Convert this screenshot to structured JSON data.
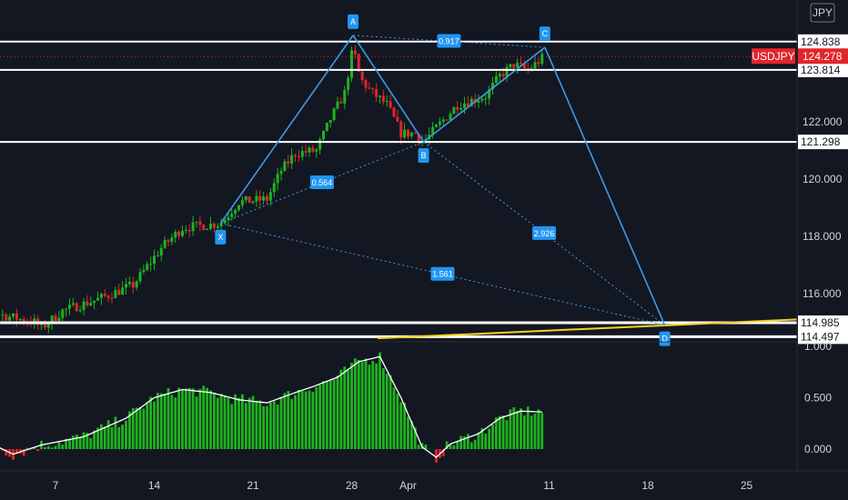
{
  "chart_data": {
    "type": "candlestick",
    "symbol": "USDJPY",
    "last_price": "124.278",
    "colors": {
      "background": "#131722",
      "up": "#1fb21f",
      "down": "#e0262c",
      "pattern": "#3d9ae8",
      "level": "#ffffff",
      "trend": "#f5d020",
      "osc_line": "#ffffff",
      "price_tag": "#e0262c",
      "text": "#d1d4dc"
    },
    "x_axis": {
      "ticks": [
        "7",
        "14",
        "21",
        "28",
        "Apr",
        "11",
        "18",
        "25"
      ]
    },
    "price_axis": {
      "ticks": [
        "122.000",
        "120.000",
        "118.000",
        "116.000"
      ],
      "ylim": [
        114.4,
        125.2
      ]
    },
    "levels": [
      {
        "value": 124.8,
        "label": "124.838"
      },
      {
        "value": 123.814,
        "label": "123.814"
      },
      {
        "value": 121.298,
        "label": "121.298"
      },
      {
        "value": 114.985,
        "label": "114.985"
      },
      {
        "value": 114.497,
        "label": "114.497"
      }
    ],
    "harmonic_points": [
      {
        "label": "X",
        "price": 118.45,
        "day": 18.7
      },
      {
        "label": "A",
        "price": 125.02,
        "day": 28.1
      },
      {
        "label": "B",
        "price": 121.3,
        "day": 33.1
      },
      {
        "label": "C",
        "price": 124.6,
        "day": 41.7
      },
      {
        "label": "D",
        "price": 114.9,
        "day": 50.2
      }
    ],
    "ratios": [
      "0.917",
      "0.564",
      "2.926",
      "1.561"
    ],
    "oscillator": {
      "ticks": [
        "1.000",
        "0.500",
        "0.000"
      ],
      "ylim": [
        -0.12,
        1.05
      ]
    }
  }
}
